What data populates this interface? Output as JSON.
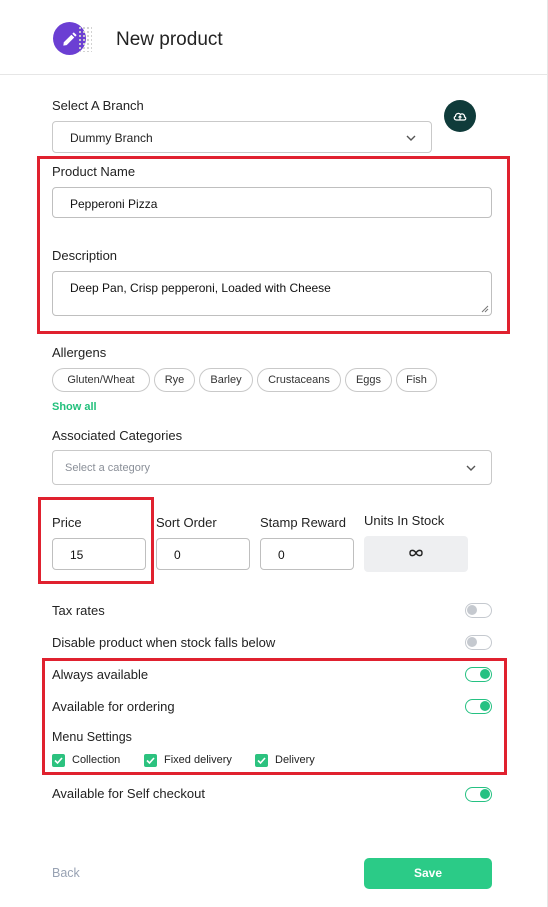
{
  "header": {
    "title": "New product"
  },
  "branch": {
    "label": "Select A Branch",
    "value": "Dummy Branch"
  },
  "product_name": {
    "label": "Product Name",
    "value": "Pepperoni Pizza"
  },
  "description": {
    "label": "Description",
    "value": "Deep Pan, Crisp pepperoni, Loaded with Cheese"
  },
  "allergens": {
    "label": "Allergens",
    "chips": [
      "Gluten/Wheat",
      "Rye",
      "Barley",
      "Crustaceans",
      "Eggs",
      "Fish"
    ],
    "show_all": "Show all"
  },
  "categories": {
    "label": "Associated Categories",
    "placeholder": "Select a category"
  },
  "price": {
    "label": "Price",
    "value": "15"
  },
  "sort_order": {
    "label": "Sort Order",
    "value": "0"
  },
  "stamp_reward": {
    "label": "Stamp Reward",
    "value": "0"
  },
  "units_in_stock": {
    "label": "Units In Stock",
    "icon": "infinity-icon"
  },
  "toggles": [
    {
      "label": "Tax rates",
      "on": false
    },
    {
      "label": "Disable product when stock falls below",
      "on": false
    },
    {
      "label": "Always available",
      "on": true
    },
    {
      "label": "Available for ordering",
      "on": true
    },
    {
      "label": "Available for Self checkout",
      "on": true
    }
  ],
  "menu_settings": {
    "label": "Menu Settings",
    "options": [
      {
        "label": "Collection",
        "checked": true
      },
      {
        "label": "Fixed delivery",
        "checked": true
      },
      {
        "label": "Delivery",
        "checked": true
      }
    ]
  },
  "footer": {
    "back_label": "Back",
    "save_label": "Save"
  },
  "colors": {
    "accent": "#2bcb87",
    "highlight": "#e0212f",
    "logo": "#6b3fd3",
    "upload": "#0f3b3a"
  }
}
